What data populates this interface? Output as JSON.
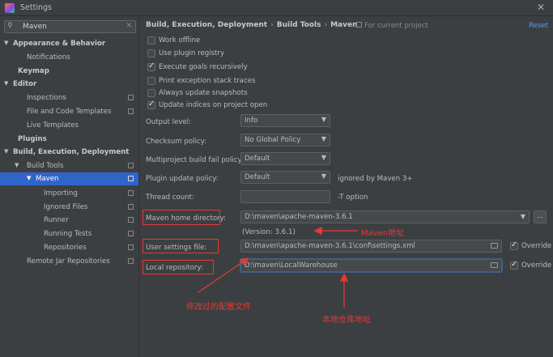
{
  "window": {
    "title": "Settings",
    "close_glyph": "✕"
  },
  "search": {
    "value": "Maven",
    "icon": "search-icon",
    "clear_glyph": "✕"
  },
  "sidebar": {
    "items": [
      {
        "label": "Appearance & Behavior",
        "arrow": "▼",
        "bold": true
      },
      {
        "label": "Notifications"
      },
      {
        "label": "Keymap",
        "bold": true
      },
      {
        "label": "Editor",
        "arrow": "▼",
        "bold": true
      },
      {
        "label": "Inspections"
      },
      {
        "label": "File and Code Templates"
      },
      {
        "label": "Live Templates"
      },
      {
        "label": "Plugins",
        "bold": true
      },
      {
        "label": "Build, Execution, Deployment",
        "arrow": "▼",
        "bold": true
      },
      {
        "label": "Build Tools",
        "arrow": "▼"
      },
      {
        "label": "Maven",
        "arrow": "▼",
        "selected": true
      },
      {
        "label": "Importing"
      },
      {
        "label": "Ignored Files"
      },
      {
        "label": "Runner"
      },
      {
        "label": "Running Tests"
      },
      {
        "label": "Repositories"
      },
      {
        "label": "Remote Jar Repositories"
      }
    ]
  },
  "breadcrumb": {
    "part1": "Build, Execution, Deployment",
    "part2": "Build Tools",
    "part3": "Maven",
    "sep": "›"
  },
  "for_project": "For current project",
  "reset": "Reset",
  "checkboxes": [
    {
      "label": "Work offline",
      "checked": false
    },
    {
      "label": "Use plugin registry",
      "checked": false
    },
    {
      "label": "Execute goals recursively",
      "checked": true
    },
    {
      "label": "Print exception stack traces",
      "checked": false
    },
    {
      "label": "Always update snapshots",
      "checked": false
    },
    {
      "label": "Update indices on project open",
      "checked": true
    }
  ],
  "fields": {
    "output_level": {
      "label": "Output level:",
      "value": "Info"
    },
    "checksum_policy": {
      "label": "Checksum policy:",
      "value": "No Global Policy"
    },
    "multiproject": {
      "label": "Multiproject build fail policy:",
      "value": "Default"
    },
    "plugin_update": {
      "label": "Plugin update policy:",
      "value": "Default",
      "note": "ignored by Maven 3+"
    },
    "thread_count": {
      "label": "Thread count:",
      "value": "",
      "note": "-T option"
    },
    "maven_home": {
      "label": "Maven home directory:",
      "value": "D:\\maven\\apache-maven-3.6.1",
      "dots": "..."
    },
    "version": "(Version: 3.6.1)",
    "user_settings": {
      "label": "User settings file:",
      "value": "D:\\maven\\apache-maven-3.6.1\\conf\\settings.xml",
      "override": "Override"
    },
    "local_repo": {
      "label": "Local repository:",
      "value": "D:\\maven\\LocalWarehouse",
      "override": "Override"
    }
  },
  "annotations": {
    "maven_addr": "Maven地址",
    "modified_config": "修改过的配置文件",
    "local_repo_addr": "本地仓库地址",
    "color": "#e53935"
  },
  "colors": {
    "selection": "#2f65ca",
    "link": "#589df6",
    "background": "#3c3f41"
  }
}
